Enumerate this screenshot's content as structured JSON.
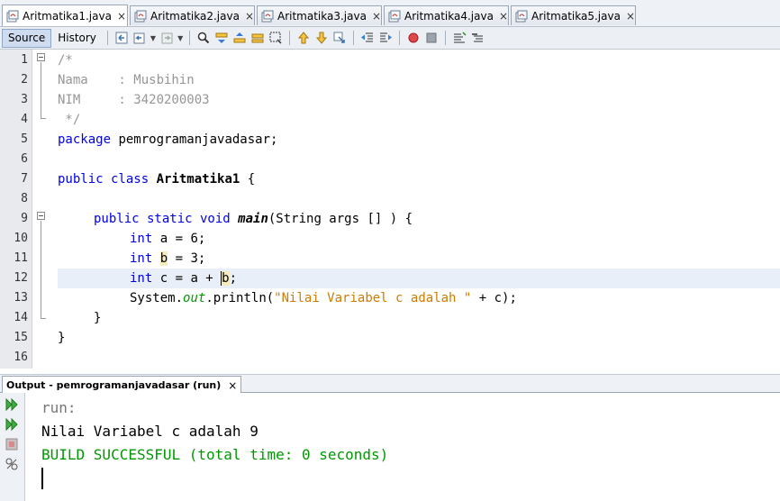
{
  "editor_tabs": [
    {
      "label": "Aritmatika1.java",
      "active": true
    },
    {
      "label": "Aritmatika2.java",
      "active": false
    },
    {
      "label": "Aritmatika3.java",
      "active": false
    },
    {
      "label": "Aritmatika4.java",
      "active": false
    },
    {
      "label": "Aritmatika5.java",
      "active": false
    }
  ],
  "tab_close_glyph": "×",
  "toolbar": {
    "source_label": "Source",
    "history_label": "History"
  },
  "line_numbers": [
    "1",
    "2",
    "3",
    "4",
    "5",
    "6",
    "7",
    "8",
    "9",
    "10",
    "11",
    "12",
    "13",
    "14",
    "15",
    "16"
  ],
  "current_line": 12,
  "code": {
    "l1": "/*",
    "l2": "Nama    : Musbihin",
    "l3": "NIM     : 3420200003",
    "l4": " */",
    "l5_kw": "package",
    "l5_rest": " pemrogramanjavadasar;",
    "l7_kw": "public class",
    "l7_cls": "Aritmatika1",
    "l7_rest": " {",
    "l9_kw": "public static void",
    "l9_mth": "main",
    "l9_rest": "(String args [] ) {",
    "l10_kw": "int",
    "l10_rest": " a = 6;",
    "l11_kw": "int",
    "l11_hl": "b",
    "l11_rest": " = 3;",
    "l12_kw": "int",
    "l12_a": " c = a + ",
    "l12_hl": "b",
    "l12_rest": ";",
    "l13_a": "System.",
    "l13_fld": "out",
    "l13_b": ".println(",
    "l13_str": "\"Nilai Variabel c adalah \"",
    "l13_rest": " + c);",
    "l14": "}",
    "l15": "}"
  },
  "output": {
    "tab_label": "Output - pemrogramanjavadasar (run)",
    "run_line": "run:",
    "message_line": "Nilai Variabel c adalah 9",
    "build_line": "BUILD SUCCESSFUL (total time: 0 seconds)"
  },
  "colors": {
    "keyword": "#0000e6",
    "comment": "#969696",
    "string": "#ce7b00",
    "field": "#009900",
    "build_success": "#009900"
  }
}
